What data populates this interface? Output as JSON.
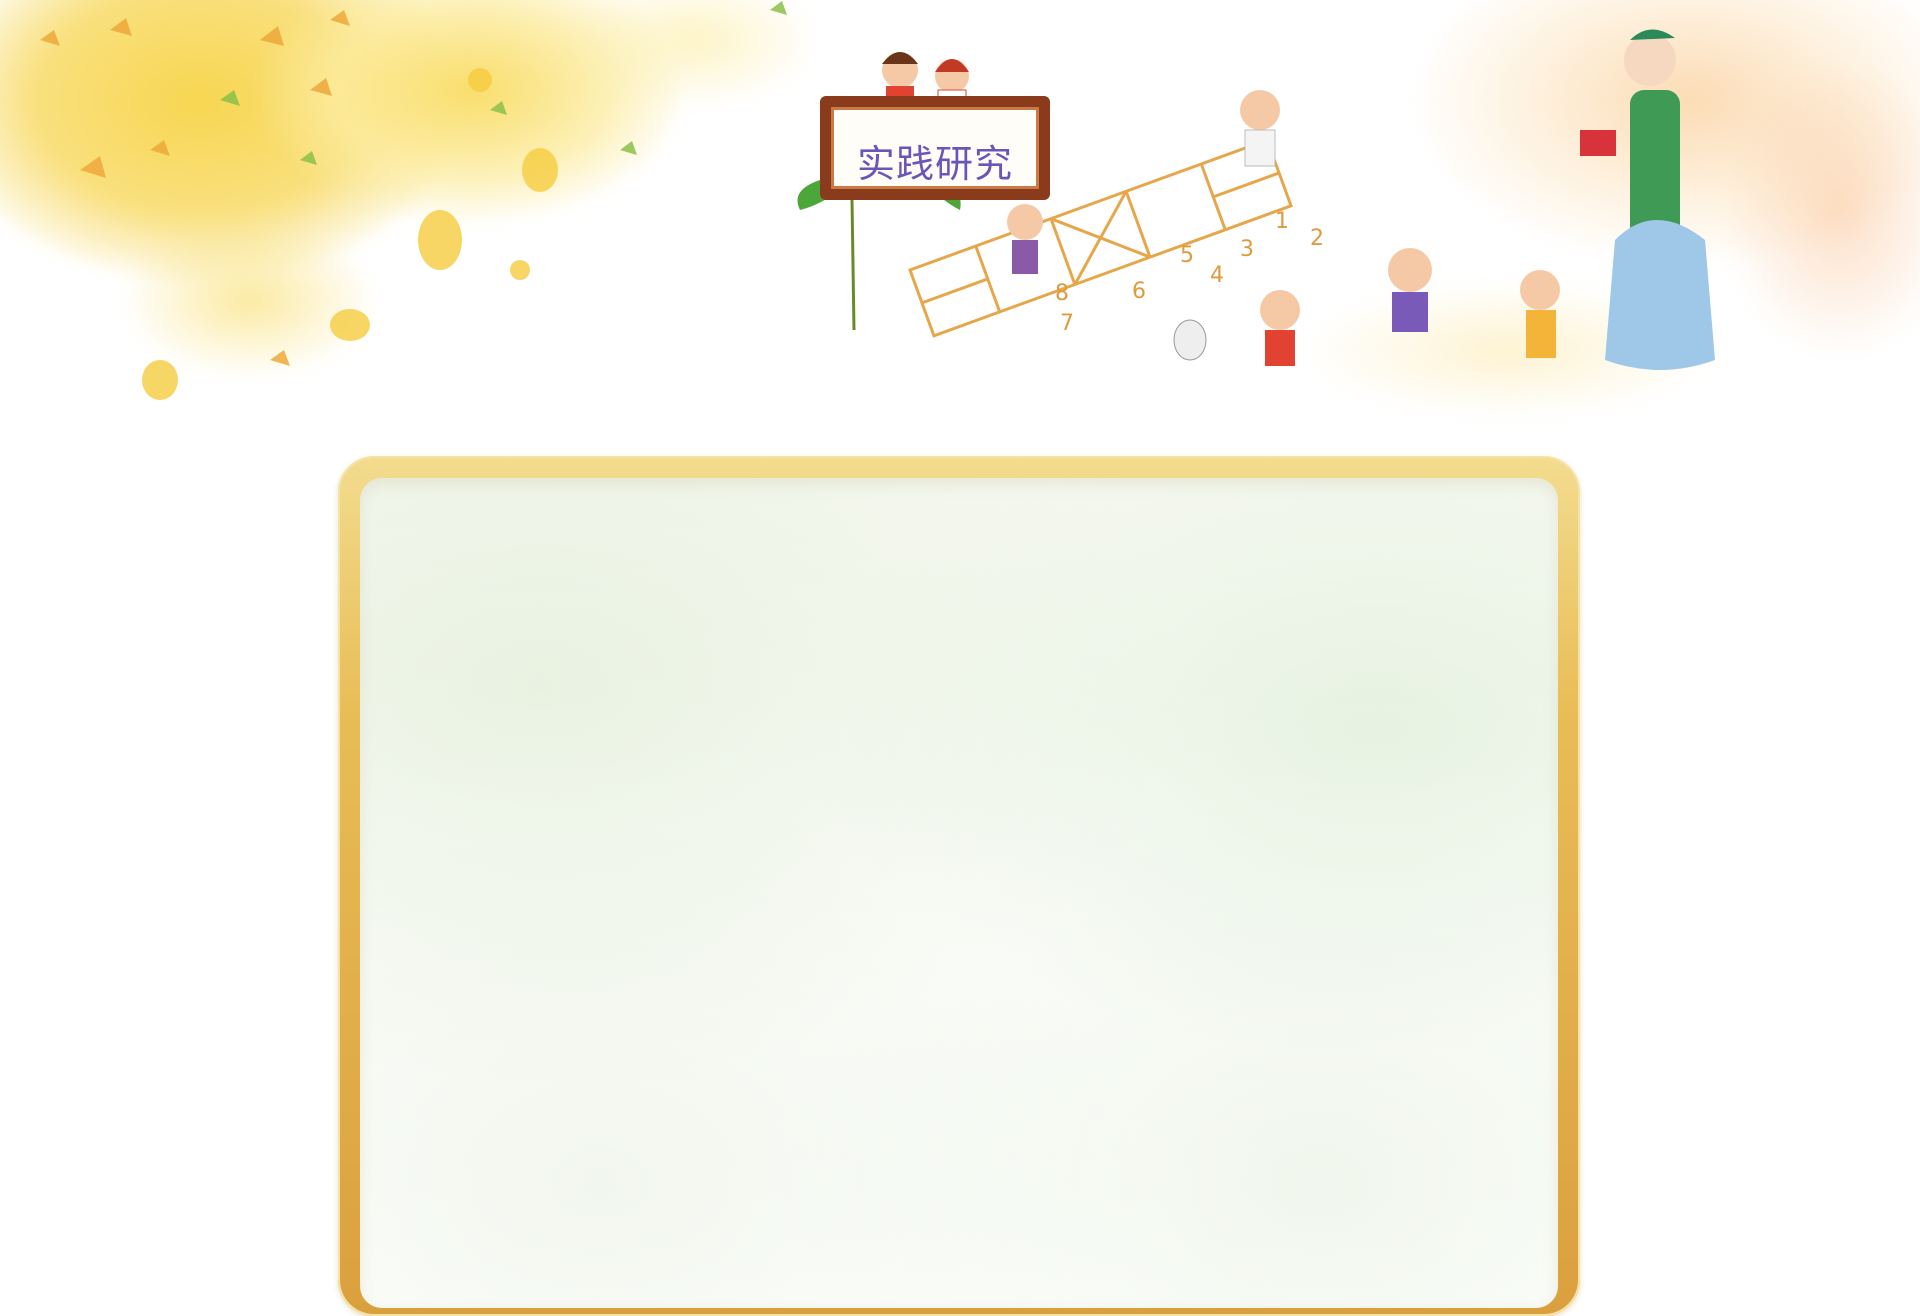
{
  "sign": {
    "title": "实践研究"
  },
  "illustration": {
    "hopscotch_numbers": [
      "1",
      "2",
      "3",
      "4",
      "5",
      "6",
      "7",
      "8"
    ]
  },
  "colors": {
    "accent_gold": "#e4b24c",
    "sign_text": "#6b55b8",
    "sign_wood": "#8a3b1c",
    "leaf_yellow": "#f6c93a"
  }
}
